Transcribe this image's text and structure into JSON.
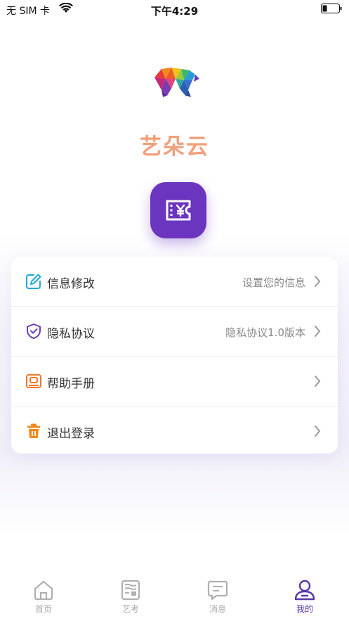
{
  "status_bar": {
    "carrier": "无 SIM 卡",
    "time": "下午4:29"
  },
  "app": {
    "name": "艺朵云"
  },
  "menu": [
    {
      "label": "信息修改",
      "value": "设置您的信息",
      "icon": "edit-icon"
    },
    {
      "label": "隐私协议",
      "value": "隐私协议1.0版本",
      "icon": "shield-icon"
    },
    {
      "label": "帮助手册",
      "value": "",
      "icon": "manual-icon"
    },
    {
      "label": "退出登录",
      "value": "",
      "icon": "trash-icon"
    }
  ],
  "tabs": [
    {
      "label": "首页",
      "icon": "home-icon"
    },
    {
      "label": "艺考",
      "icon": "exam-icon"
    },
    {
      "label": "消息",
      "icon": "message-icon"
    },
    {
      "label": "我的",
      "icon": "profile-icon",
      "active": true
    }
  ],
  "colors": {
    "accent": "#6b35bf",
    "title": "#f0a07a",
    "tab_active": "#5a35a8"
  }
}
